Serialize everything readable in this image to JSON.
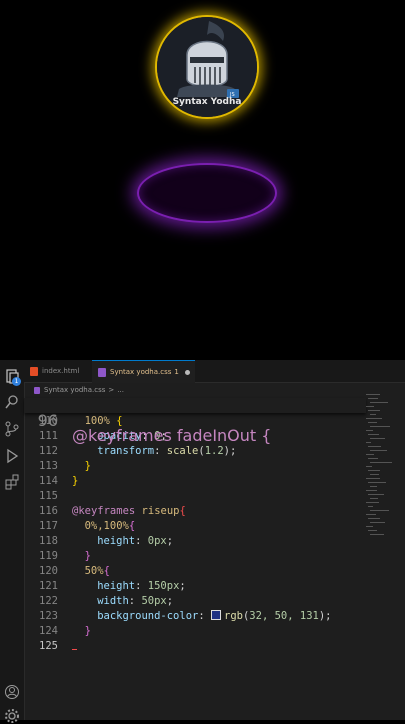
{
  "preview": {
    "logo_text": "Syntax Yodha"
  },
  "editor": {
    "activity_badge": "1",
    "tabs": [
      {
        "label": "index.html"
      },
      {
        "label": "Syntax yodha.css",
        "modified": "1"
      }
    ],
    "breadcrumb": {
      "file": "Syntax yodha.css",
      "sep": ">",
      "rest": "..."
    },
    "sticky": {
      "num": "96",
      "text": "@keyframes fadeInOut {"
    },
    "lines": [
      {
        "num": "110",
        "parts": [
          "100%",
          " {"
        ]
      },
      {
        "num": "111",
        "parts": [
          "opacity",
          ": ",
          "0",
          ";"
        ]
      },
      {
        "num": "112",
        "parts": [
          "transform",
          ": ",
          "scale",
          "(",
          "1.2",
          ");"
        ]
      },
      {
        "num": "113",
        "parts": [
          "}"
        ]
      },
      {
        "num": "114",
        "parts": [
          "}"
        ]
      },
      {
        "num": "115",
        "parts": []
      },
      {
        "num": "116",
        "parts": [
          "@keyframes",
          " ",
          "riseup",
          "{"
        ]
      },
      {
        "num": "117",
        "parts": [
          "0%,100%",
          "{"
        ]
      },
      {
        "num": "118",
        "parts": [
          "height",
          ": ",
          "0px",
          ";"
        ]
      },
      {
        "num": "119",
        "parts": [
          "}"
        ]
      },
      {
        "num": "120",
        "parts": [
          "50%",
          "{"
        ]
      },
      {
        "num": "121",
        "parts": [
          "height",
          ": ",
          "150px",
          ";"
        ]
      },
      {
        "num": "122",
        "parts": [
          "width",
          ": ",
          "50px",
          ";"
        ]
      },
      {
        "num": "123",
        "parts": [
          "background-color",
          ": ",
          "rgb",
          "(",
          "32, 50, 131",
          ");"
        ]
      },
      {
        "num": "124",
        "parts": [
          "}"
        ]
      },
      {
        "num": "125",
        "parts": []
      }
    ],
    "swatch_color": "#203283"
  }
}
